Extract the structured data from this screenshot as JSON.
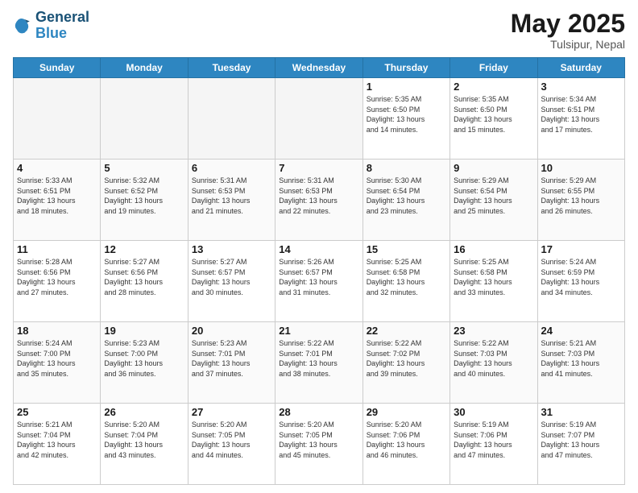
{
  "header": {
    "logo_line1": "General",
    "logo_line2": "Blue",
    "month": "May 2025",
    "location": "Tulsipur, Nepal"
  },
  "days_of_week": [
    "Sunday",
    "Monday",
    "Tuesday",
    "Wednesday",
    "Thursday",
    "Friday",
    "Saturday"
  ],
  "weeks": [
    [
      {
        "day": "",
        "info": ""
      },
      {
        "day": "",
        "info": ""
      },
      {
        "day": "",
        "info": ""
      },
      {
        "day": "",
        "info": ""
      },
      {
        "day": "1",
        "info": "Sunrise: 5:35 AM\nSunset: 6:50 PM\nDaylight: 13 hours\nand 14 minutes."
      },
      {
        "day": "2",
        "info": "Sunrise: 5:35 AM\nSunset: 6:50 PM\nDaylight: 13 hours\nand 15 minutes."
      },
      {
        "day": "3",
        "info": "Sunrise: 5:34 AM\nSunset: 6:51 PM\nDaylight: 13 hours\nand 17 minutes."
      }
    ],
    [
      {
        "day": "4",
        "info": "Sunrise: 5:33 AM\nSunset: 6:51 PM\nDaylight: 13 hours\nand 18 minutes."
      },
      {
        "day": "5",
        "info": "Sunrise: 5:32 AM\nSunset: 6:52 PM\nDaylight: 13 hours\nand 19 minutes."
      },
      {
        "day": "6",
        "info": "Sunrise: 5:31 AM\nSunset: 6:53 PM\nDaylight: 13 hours\nand 21 minutes."
      },
      {
        "day": "7",
        "info": "Sunrise: 5:31 AM\nSunset: 6:53 PM\nDaylight: 13 hours\nand 22 minutes."
      },
      {
        "day": "8",
        "info": "Sunrise: 5:30 AM\nSunset: 6:54 PM\nDaylight: 13 hours\nand 23 minutes."
      },
      {
        "day": "9",
        "info": "Sunrise: 5:29 AM\nSunset: 6:54 PM\nDaylight: 13 hours\nand 25 minutes."
      },
      {
        "day": "10",
        "info": "Sunrise: 5:29 AM\nSunset: 6:55 PM\nDaylight: 13 hours\nand 26 minutes."
      }
    ],
    [
      {
        "day": "11",
        "info": "Sunrise: 5:28 AM\nSunset: 6:56 PM\nDaylight: 13 hours\nand 27 minutes."
      },
      {
        "day": "12",
        "info": "Sunrise: 5:27 AM\nSunset: 6:56 PM\nDaylight: 13 hours\nand 28 minutes."
      },
      {
        "day": "13",
        "info": "Sunrise: 5:27 AM\nSunset: 6:57 PM\nDaylight: 13 hours\nand 30 minutes."
      },
      {
        "day": "14",
        "info": "Sunrise: 5:26 AM\nSunset: 6:57 PM\nDaylight: 13 hours\nand 31 minutes."
      },
      {
        "day": "15",
        "info": "Sunrise: 5:25 AM\nSunset: 6:58 PM\nDaylight: 13 hours\nand 32 minutes."
      },
      {
        "day": "16",
        "info": "Sunrise: 5:25 AM\nSunset: 6:58 PM\nDaylight: 13 hours\nand 33 minutes."
      },
      {
        "day": "17",
        "info": "Sunrise: 5:24 AM\nSunset: 6:59 PM\nDaylight: 13 hours\nand 34 minutes."
      }
    ],
    [
      {
        "day": "18",
        "info": "Sunrise: 5:24 AM\nSunset: 7:00 PM\nDaylight: 13 hours\nand 35 minutes."
      },
      {
        "day": "19",
        "info": "Sunrise: 5:23 AM\nSunset: 7:00 PM\nDaylight: 13 hours\nand 36 minutes."
      },
      {
        "day": "20",
        "info": "Sunrise: 5:23 AM\nSunset: 7:01 PM\nDaylight: 13 hours\nand 37 minutes."
      },
      {
        "day": "21",
        "info": "Sunrise: 5:22 AM\nSunset: 7:01 PM\nDaylight: 13 hours\nand 38 minutes."
      },
      {
        "day": "22",
        "info": "Sunrise: 5:22 AM\nSunset: 7:02 PM\nDaylight: 13 hours\nand 39 minutes."
      },
      {
        "day": "23",
        "info": "Sunrise: 5:22 AM\nSunset: 7:03 PM\nDaylight: 13 hours\nand 40 minutes."
      },
      {
        "day": "24",
        "info": "Sunrise: 5:21 AM\nSunset: 7:03 PM\nDaylight: 13 hours\nand 41 minutes."
      }
    ],
    [
      {
        "day": "25",
        "info": "Sunrise: 5:21 AM\nSunset: 7:04 PM\nDaylight: 13 hours\nand 42 minutes."
      },
      {
        "day": "26",
        "info": "Sunrise: 5:20 AM\nSunset: 7:04 PM\nDaylight: 13 hours\nand 43 minutes."
      },
      {
        "day": "27",
        "info": "Sunrise: 5:20 AM\nSunset: 7:05 PM\nDaylight: 13 hours\nand 44 minutes."
      },
      {
        "day": "28",
        "info": "Sunrise: 5:20 AM\nSunset: 7:05 PM\nDaylight: 13 hours\nand 45 minutes."
      },
      {
        "day": "29",
        "info": "Sunrise: 5:20 AM\nSunset: 7:06 PM\nDaylight: 13 hours\nand 46 minutes."
      },
      {
        "day": "30",
        "info": "Sunrise: 5:19 AM\nSunset: 7:06 PM\nDaylight: 13 hours\nand 47 minutes."
      },
      {
        "day": "31",
        "info": "Sunrise: 5:19 AM\nSunset: 7:07 PM\nDaylight: 13 hours\nand 47 minutes."
      }
    ]
  ]
}
